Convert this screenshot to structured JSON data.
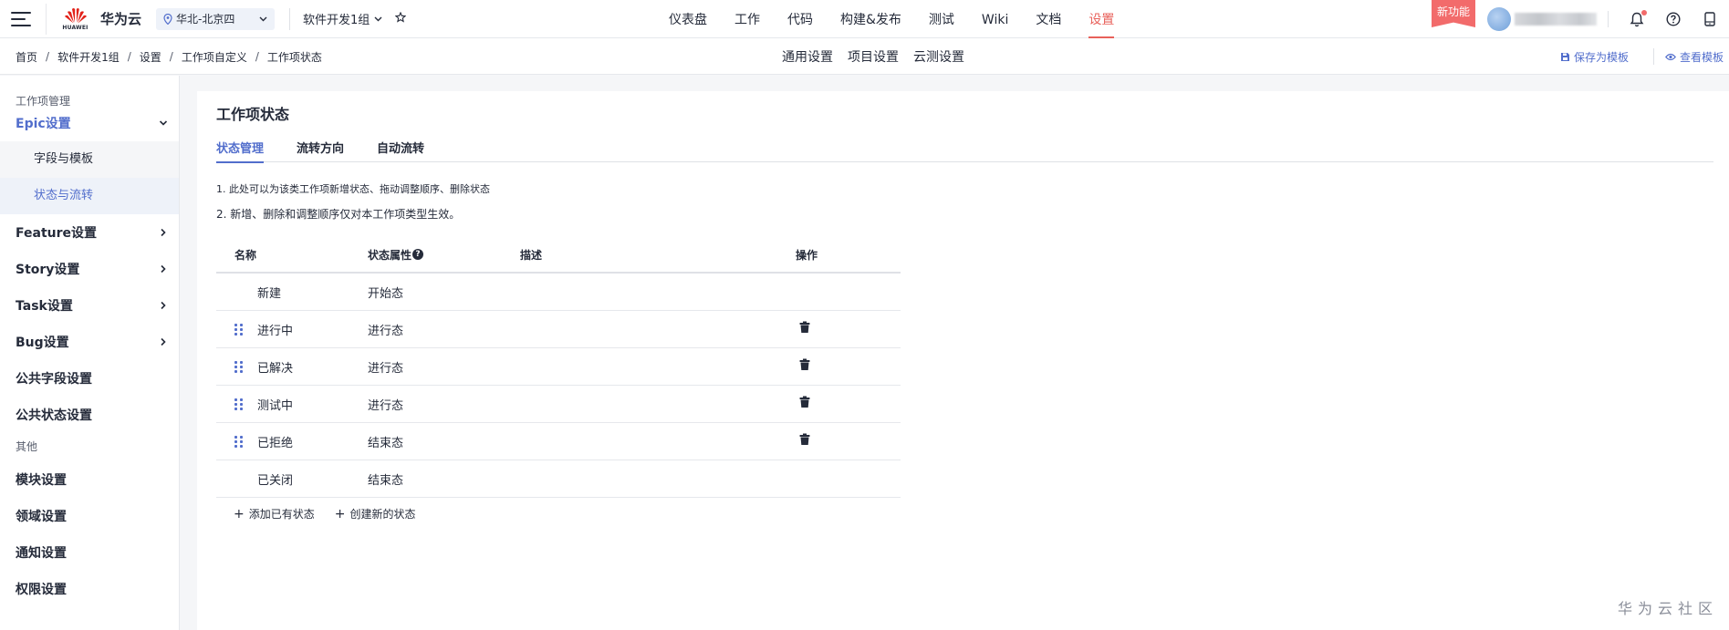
{
  "topbar": {
    "brand_logo_text": "HUAWEI",
    "brand": "华为云",
    "region": "华北-北京四",
    "project": "软件开发1组",
    "nav": [
      "仪表盘",
      "工作",
      "代码",
      "构建&发布",
      "测试",
      "Wiki",
      "文档",
      "设置"
    ],
    "new_feature": "新功能"
  },
  "breadcrumb": [
    "首页",
    "软件开发1组",
    "设置",
    "工作项自定义",
    "工作项状态"
  ],
  "subnav": [
    "通用设置",
    "项目设置",
    "云测设置"
  ],
  "template": {
    "save": "保存为模板",
    "view": "查看模板"
  },
  "sidebar": {
    "group1": "工作项管理",
    "epic": "Epic设置",
    "epic_sub": [
      "字段与模板",
      "状态与流转"
    ],
    "items": [
      "Feature设置",
      "Story设置",
      "Task设置",
      "Bug设置"
    ],
    "items2": [
      "公共字段设置",
      "公共状态设置"
    ],
    "group2": "其他",
    "others": [
      "模块设置",
      "领域设置",
      "通知设置",
      "权限设置"
    ]
  },
  "page": {
    "title": "工作项状态",
    "tabs": [
      "状态管理",
      "流转方向",
      "自动流转"
    ],
    "note1": "1. 此处可以为该类工作项新增状态、拖动调整顺序、删除状态",
    "note2": "2. 新增、删除和调整顺序仅对本工作项类型生效。"
  },
  "table": {
    "headers": {
      "name": "名称",
      "attr": "状态属性",
      "desc": "描述",
      "op": "操作"
    },
    "rows": [
      {
        "name": "新建",
        "attr": "开始态",
        "desc": ""
      },
      {
        "name": "进行中",
        "attr": "进行态",
        "desc": ""
      },
      {
        "name": "已解决",
        "attr": "进行态",
        "desc": ""
      },
      {
        "name": "测试中",
        "attr": "进行态",
        "desc": ""
      },
      {
        "name": "已拒绝",
        "attr": "结束态",
        "desc": ""
      },
      {
        "name": "已关闭",
        "attr": "结束态",
        "desc": ""
      }
    ]
  },
  "actions": {
    "add_existing": "添加已有状态",
    "create_new": "创建新的状态"
  },
  "watermark": "华为云社区",
  "colors": {
    "accent": "#526ecc",
    "active_nav": "#e8605a",
    "badge": "#f26b6b"
  }
}
